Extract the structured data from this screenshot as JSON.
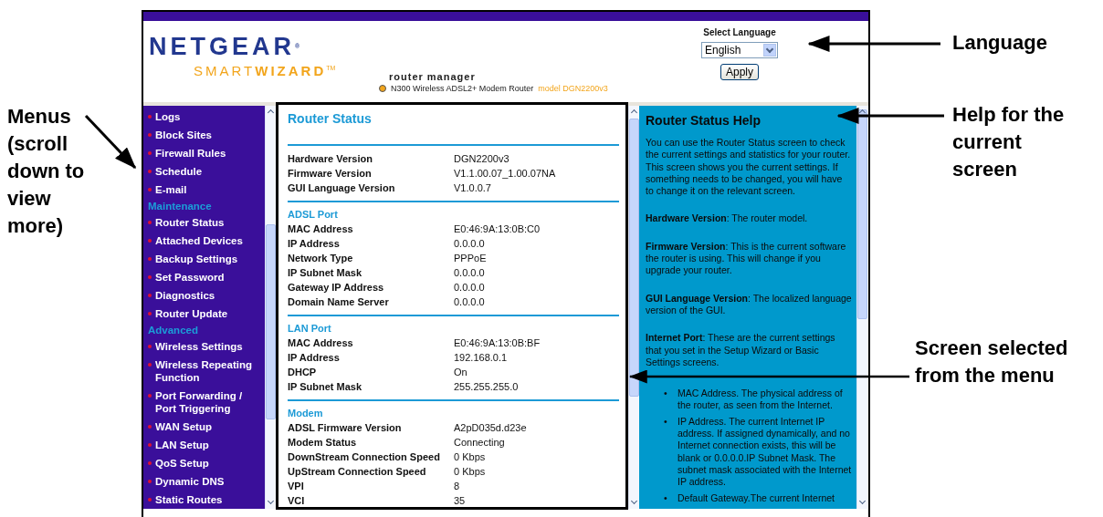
{
  "callouts": [
    {
      "text": "Menus (scroll down to view more)"
    },
    {
      "text": "Language"
    },
    {
      "text": "Help for the current screen"
    },
    {
      "text": "Screen selected from the menu"
    }
  ],
  "header": {
    "logo_top": "NETGEAR",
    "logo_mark": "®",
    "logo_smart": "SMART",
    "logo_wizard": "WIZARD",
    "logo_tm": "TM",
    "product": "router manager",
    "device": "N300 Wireless ADSL2+ Modem Router",
    "model": "model DGN2200v3",
    "language_label": "Select Language",
    "language_value": "English",
    "apply": "Apply"
  },
  "menu": [
    {
      "kind": "item",
      "label": "Logs"
    },
    {
      "kind": "item",
      "label": "Block Sites"
    },
    {
      "kind": "item",
      "label": "Firewall Rules"
    },
    {
      "kind": "item",
      "label": "Schedule"
    },
    {
      "kind": "item",
      "label": "E-mail"
    },
    {
      "kind": "heading",
      "label": "Maintenance"
    },
    {
      "kind": "item",
      "label": "Router Status"
    },
    {
      "kind": "item",
      "label": "Attached Devices"
    },
    {
      "kind": "item",
      "label": "Backup Settings"
    },
    {
      "kind": "item",
      "label": "Set Password"
    },
    {
      "kind": "item",
      "label": "Diagnostics"
    },
    {
      "kind": "item",
      "label": "Router Update"
    },
    {
      "kind": "heading",
      "label": "Advanced"
    },
    {
      "kind": "item",
      "label": "Wireless Settings"
    },
    {
      "kind": "item",
      "label": "Wireless Repeating Function"
    },
    {
      "kind": "item",
      "label": "Port Forwarding / Port Triggering"
    },
    {
      "kind": "item",
      "label": "WAN Setup"
    },
    {
      "kind": "item",
      "label": "LAN Setup"
    },
    {
      "kind": "item",
      "label": "QoS Setup"
    },
    {
      "kind": "item",
      "label": "Dynamic DNS"
    },
    {
      "kind": "item",
      "label": "Static Routes"
    }
  ],
  "status": {
    "title": "Router Status",
    "sections": [
      {
        "rows": [
          {
            "label": "Hardware Version",
            "value": "DGN2200v3"
          },
          {
            "label": "Firmware Version",
            "value": "V1.1.00.07_1.00.07NA"
          },
          {
            "label": "GUI Language Version",
            "value": "V1.0.0.7"
          }
        ]
      },
      {
        "heading": "ADSL Port",
        "rows": [
          {
            "label": "MAC Address",
            "value": "E0:46:9A:13:0B:C0"
          },
          {
            "label": "IP Address",
            "value": "0.0.0.0"
          },
          {
            "label": "Network Type",
            "value": "PPPoE"
          },
          {
            "label": "IP Subnet Mask",
            "value": "0.0.0.0"
          },
          {
            "label": "Gateway IP Address",
            "value": "0.0.0.0"
          },
          {
            "label": "Domain Name Server",
            "value": "0.0.0.0"
          }
        ]
      },
      {
        "heading": "LAN Port",
        "rows": [
          {
            "label": "MAC Address",
            "value": "E0:46:9A:13:0B:BF"
          },
          {
            "label": "IP Address",
            "value": "192.168.0.1"
          },
          {
            "label": "DHCP",
            "value": "On"
          },
          {
            "label": "IP Subnet Mask",
            "value": "255.255.255.0"
          }
        ]
      },
      {
        "heading": "Modem",
        "rows": [
          {
            "label": "ADSL Firmware Version",
            "value": "A2pD035d.d23e"
          },
          {
            "label": "Modem Status",
            "value": "Connecting"
          },
          {
            "label": "DownStream Connection Speed",
            "value": "0 Kbps"
          },
          {
            "label": "UpStream Connection Speed",
            "value": "0 Kbps"
          },
          {
            "label": "VPI",
            "value": "8"
          },
          {
            "label": "VCI",
            "value": "35"
          }
        ]
      }
    ]
  },
  "help": {
    "title": "Router Status Help",
    "paragraphs": [
      "You can use the Router Status screen to check the current settings and statistics for your router. This screen shows you the current settings. If something needs to be changed, you will have to change it on the relevant screen.",
      "**Hardware Version**: The router model.",
      "**Firmware Version**: This is the current software the router is using. This will change if you upgrade your router.",
      "**GUI Language Version**: The localized language version of the GUI.",
      "**Internet Port**: These are the current settings that you set in the Setup Wizard or Basic Settings screens."
    ],
    "bullets": [
      {
        "marker": "•",
        "text": "MAC Address. The physical address of the router, as seen from the Internet."
      },
      {
        "marker": "•",
        "text": "IP Address. The current Internet IP address. If assigned dynamically, and no Internet connection exists, this will be blank or 0.0.0.0.IP Subnet Mask. The subnet mask associated with the Internet IP address."
      },
      {
        "marker": "•",
        "text": "Default Gateway.The current Internet"
      }
    ]
  }
}
